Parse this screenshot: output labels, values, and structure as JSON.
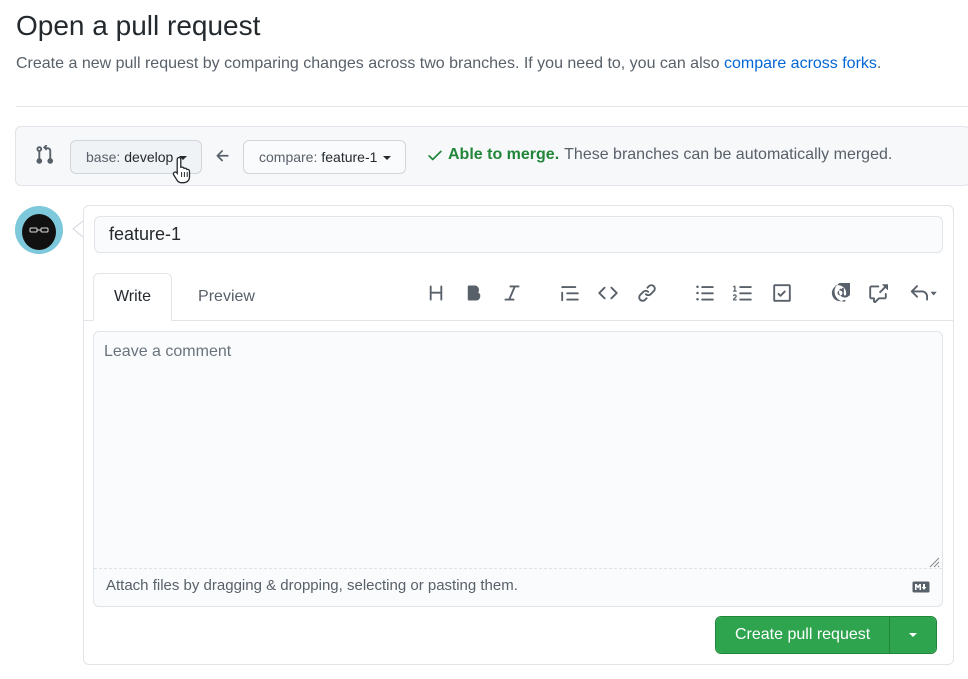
{
  "header": {
    "title": "Open a pull request",
    "subtitle_prefix": "Create a new pull request by comparing changes across two branches. If you need to, you can also ",
    "subtitle_link": "compare across forks",
    "subtitle_suffix": "."
  },
  "range": {
    "base_label": "base:",
    "base_value": "develop",
    "compare_label": "compare:",
    "compare_value": "feature-1",
    "merge_status_bold": "Able to merge.",
    "merge_status_text": "These branches can be automatically merged."
  },
  "form": {
    "title_value": "feature-1",
    "tabs": {
      "write": "Write",
      "preview": "Preview"
    },
    "toolbar": [
      "heading-icon",
      "bold-icon",
      "italic-icon",
      "quote-icon",
      "code-icon",
      "link-icon",
      "unordered-list-icon",
      "ordered-list-icon",
      "task-list-icon",
      "mention-icon",
      "cross-reference-icon",
      "reply-icon"
    ],
    "comment_placeholder": "Leave a comment",
    "attach_text": "Attach files by dragging & dropping, selecting or pasting them.",
    "create_button": "Create pull request"
  },
  "colors": {
    "link": "#0366d6",
    "success": "#22863a",
    "button_green": "#2ea44f"
  }
}
